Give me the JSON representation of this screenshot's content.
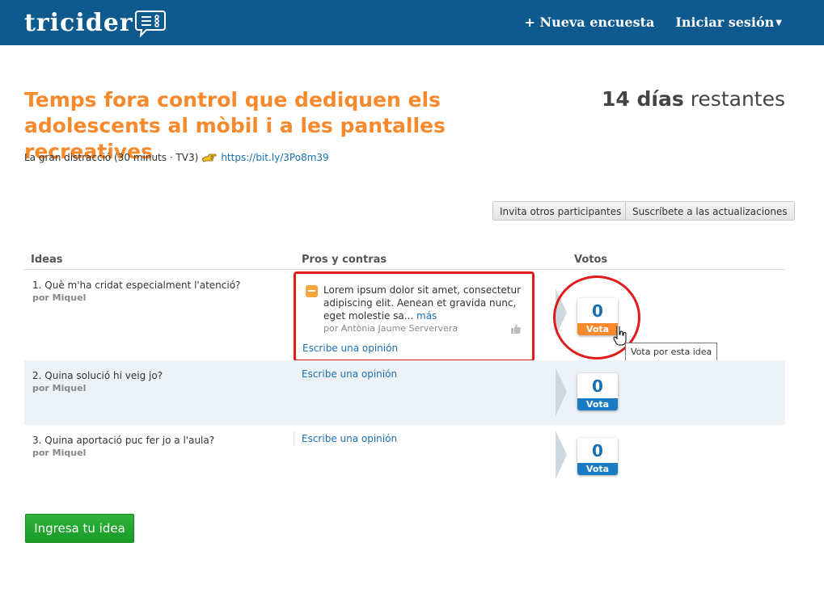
{
  "header": {
    "logo_text": "tricider",
    "nav": {
      "new_survey": "+ Nueva encuesta",
      "login": "Iniciar sesión"
    }
  },
  "survey": {
    "title": "Temps fora control que dediquen els adolescents al mòbil i a les pantalles recreatives",
    "days_number": "14 días",
    "days_suffix": "restantes",
    "subtitle": "La gran distracció (30 minuts · TV3)",
    "link": "https://bit.ly/3Po8m39"
  },
  "actions": {
    "invite": "Invita otros participantes",
    "subscribe": "Suscríbete a las actualizaciones"
  },
  "table": {
    "headers": {
      "ideas": "Ideas",
      "pros": "Pros y contras",
      "votes": "Votos"
    },
    "rows": [
      {
        "idea": "1. Què m'ha cridat especialment l'atenció?",
        "author": "por Miquel",
        "pro": {
          "text": "Lorem ipsum dolor sit amet, consectetur adipiscing elit. Aenean et gravida nunc, eget molestie sa...",
          "more": "más",
          "author": "por Antònia Jaume Serververa"
        },
        "write": "Escribe una opinión",
        "votes": "0",
        "vote_label": "Vota"
      },
      {
        "idea": "2. Quina solució hi veig jo?",
        "author": "por Miquel",
        "write": "Escribe una opinión",
        "votes": "0",
        "vote_label": "Vota"
      },
      {
        "idea": "3. Quina aportació puc fer jo a l'aula?",
        "author": "por Miquel",
        "write": "Escribe una opinión",
        "votes": "0",
        "vote_label": "Vota"
      }
    ]
  },
  "tooltip": "Vota por esta idea",
  "add_idea": "Ingresa tu idea",
  "colors": {
    "header_bg": "#0e5a8e",
    "accent_orange": "#f7892d",
    "link_blue": "#1a6fb3",
    "highlight_red": "#e01b1b",
    "green_button": "#1b9a28"
  },
  "icons": [
    "speech-bubble-logo-icon",
    "caret-down-icon",
    "pointing-hand-icon",
    "thumbs-up-icon",
    "minus-badge-icon",
    "hand-cursor-icon"
  ]
}
